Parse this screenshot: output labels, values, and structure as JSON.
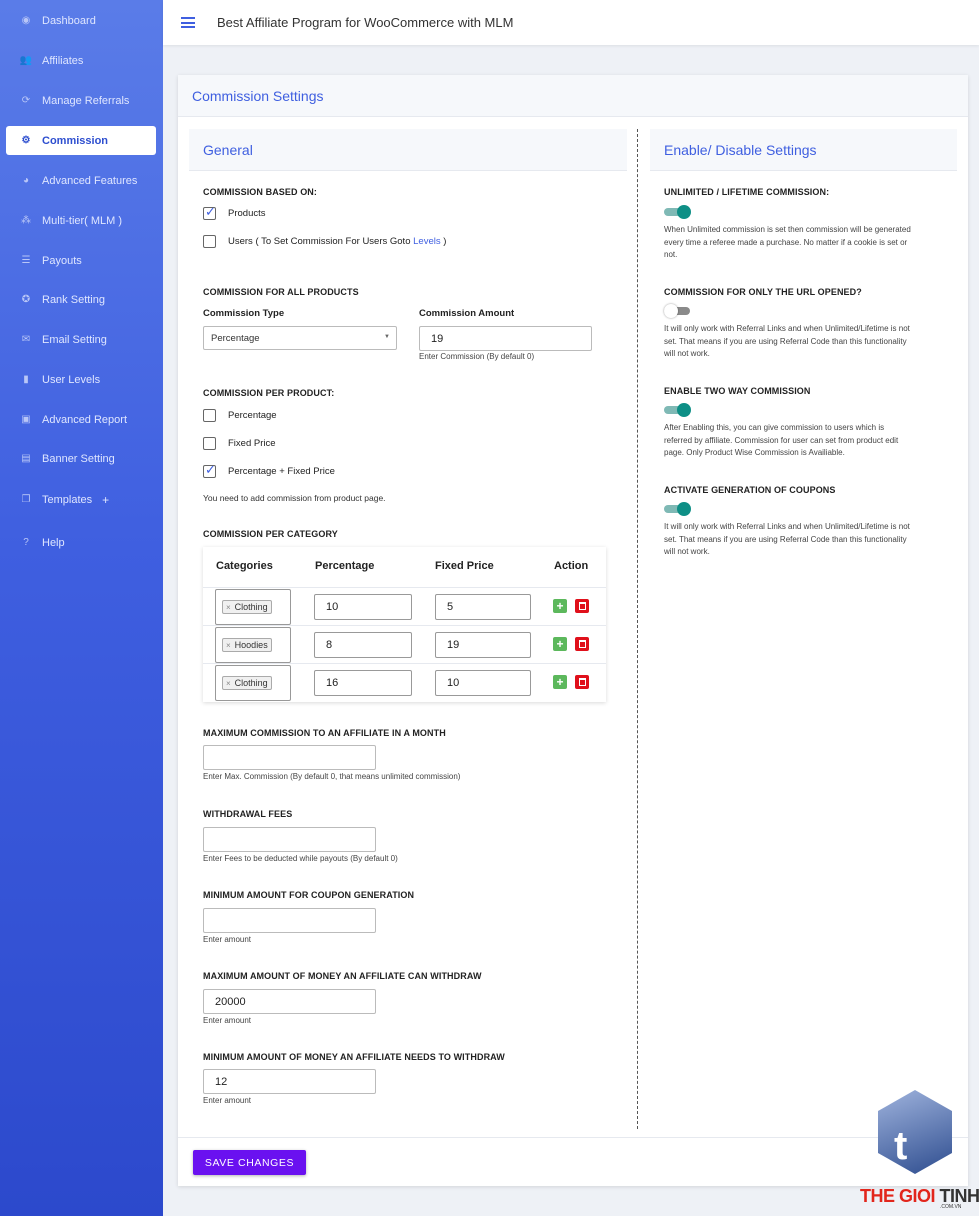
{
  "app": {
    "title": "Best Affiliate Program for WooCommerce with MLM"
  },
  "sidebar": {
    "items": [
      {
        "label": "Dashboard",
        "icon": "eye-icon"
      },
      {
        "label": "Affiliates",
        "icon": "users-icon"
      },
      {
        "label": "Manage Referrals",
        "icon": "refresh-icon"
      },
      {
        "label": "Commission",
        "icon": "gear-icon",
        "active": true
      },
      {
        "label": "Advanced Features",
        "icon": "palette-icon"
      },
      {
        "label": "Multi-tier( MLM )",
        "icon": "network-icon"
      },
      {
        "label": "Payouts",
        "icon": "list-icon"
      },
      {
        "label": "Rank Setting",
        "icon": "star-icon"
      },
      {
        "label": "Email Setting",
        "icon": "mail-icon"
      },
      {
        "label": "User Levels",
        "icon": "bars-icon"
      },
      {
        "label": "Advanced Report",
        "icon": "report-icon"
      },
      {
        "label": "Banner Setting",
        "icon": "banner-icon"
      },
      {
        "label": "Templates",
        "icon": "template-icon",
        "suffix": "+"
      },
      {
        "label": "Help",
        "icon": "help-icon"
      }
    ]
  },
  "page": {
    "title": "Commission Settings"
  },
  "general": {
    "title": "General",
    "based_on": {
      "label": "COMMISSION BASED ON:",
      "products": "Products",
      "users_prefix": "Users ( To Set Commission For Users Goto ",
      "users_link": "Levels",
      "users_suffix": " )"
    },
    "all_products": {
      "label": "COMMISSION FOR ALL PRODUCTS",
      "type_label": "Commission Type",
      "type_value": "Percentage",
      "amount_label": "Commission Amount",
      "amount_value": "19",
      "amount_help": "Enter Commission (By default 0)"
    },
    "per_product": {
      "label": "COMMISSION PER PRODUCT:",
      "options": [
        "Percentage",
        "Fixed Price",
        "Percentage + Fixed Price"
      ],
      "note": "You need to add commission from product page."
    },
    "per_category": {
      "label": "COMMISSION PER CATEGORY",
      "headers": [
        "Categories",
        "Percentage",
        "Fixed Price",
        "Action"
      ],
      "rows": [
        {
          "category": "Clothing",
          "percentage": "10",
          "fixed": "5"
        },
        {
          "category": "Hoodies",
          "percentage": "8",
          "fixed": "19"
        },
        {
          "category": "Clothing",
          "percentage": "16",
          "fixed": "10"
        }
      ],
      "tag_remove": "×",
      "add_symbol": "+"
    },
    "max_month": {
      "label": "MAXIMUM COMMISSION TO AN AFFILIATE IN A MONTH",
      "value": "",
      "help": "Enter Max. Commission (By default 0, that means unlimited commission)"
    },
    "withdrawal_fees": {
      "label": "WITHDRAWAL FEES",
      "value": "",
      "help": "Enter Fees to be deducted while payouts (By default 0)"
    },
    "min_coupon": {
      "label": "MINIMUM AMOUNT FOR COUPON GENERATION",
      "value": "",
      "help": "Enter amount"
    },
    "max_withdraw": {
      "label": "MAXIMUM AMOUNT OF MONEY AN AFFILIATE CAN WITHDRAW",
      "value": "20000",
      "help": "Enter amount"
    },
    "min_withdraw": {
      "label": "MINIMUM AMOUNT OF MONEY AN AFFILIATE NEEDS TO WITHDRAW",
      "value": "12",
      "help": "Enter amount"
    }
  },
  "settings": {
    "title": "Enable/ Disable Settings",
    "items": [
      {
        "label": "UNLIMITED / LIFETIME COMMISSION:",
        "on": true,
        "help": [
          "When Unlimited commission is set then commission will be generated",
          "every time a referee made a purchase. No matter if a cookie is set or",
          "not."
        ]
      },
      {
        "label": "COMMISSION FOR ONLY THE URL OPENED?",
        "on": false,
        "help": [
          "It will only work with Referral Links and when Unlimited/Lifetime is not",
          "set. That means if you are using Referral Code than this functionality",
          "will not work."
        ]
      },
      {
        "label": "ENABLE TWO WAY COMMISSION",
        "on": true,
        "help": [
          "After Enabling this, you can give commission to users which is",
          "referred by affiliate. Commission for user can set from product edit",
          "page. Only Product Wise Commission is Availiable."
        ]
      },
      {
        "label": "ACTIVATE GENERATION OF COUPONS",
        "on": true,
        "help": [
          "It will only work with Referral Links and when Unlimited/Lifetime is not",
          "set. That means if you are using Referral Code than this functionality",
          "will not work."
        ]
      }
    ]
  },
  "actions": {
    "save": "SAVE CHANGES"
  },
  "watermark": {
    "letter": "t",
    "brand_red": "THE GIOI ",
    "brand_dark": "TINHOC",
    "domain": ".COM.VN"
  },
  "colors": {
    "primary": "#3f5fe0",
    "save": "#6a11f0",
    "toggle_on": "#0e8f86",
    "add": "#5cb85c",
    "delete": "#e0101b"
  }
}
